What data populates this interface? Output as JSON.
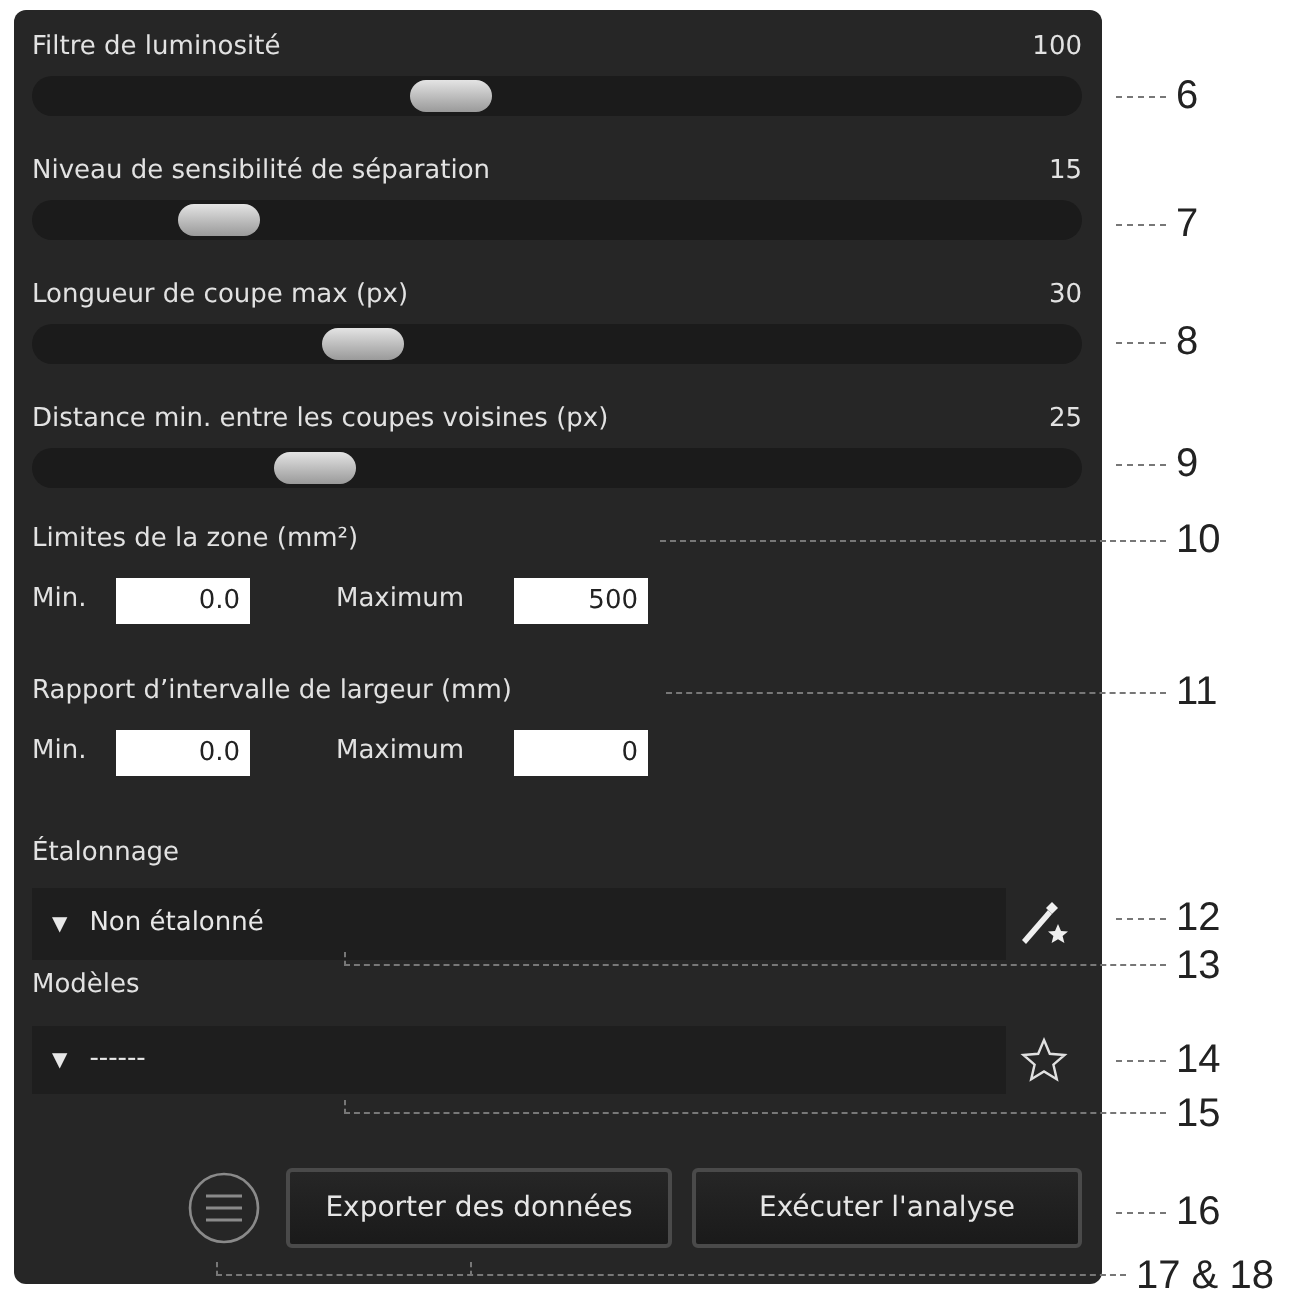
{
  "sliders": [
    {
      "label": "Filtre de luminosité",
      "reading": "100",
      "level": 0.39
    },
    {
      "label": "Niveau de sensibilité de séparation",
      "reading": "15",
      "level": 0.15
    },
    {
      "label": "Longueur de coupe max (px)",
      "reading": "30",
      "level": 0.3
    },
    {
      "label": "Distance min. entre les coupes voisines (px)",
      "reading": "25",
      "level": 0.25
    }
  ],
  "ranges": [
    {
      "label": "Limites de la zone (mm²)",
      "min_label": "Min.",
      "min_value": "0.0",
      "max_label": "Maximum",
      "max_value": "500"
    },
    {
      "label": "Rapport d’intervalle de largeur (mm)",
      "min_label": "Min.",
      "min_value": "0.0",
      "max_label": "Maximum",
      "max_value": "0"
    }
  ],
  "calibration": {
    "label": "Étalonnage",
    "arrow": "▼",
    "value": "Non étalonné"
  },
  "models": {
    "label": "Modèles",
    "arrow": "▼",
    "value": "------"
  },
  "buttons": [
    "Exporter des données",
    "Exécuter l'analyse"
  ],
  "callouts": [
    "6",
    "7",
    "8",
    "9",
    "10",
    "11",
    "12",
    "13",
    "14",
    "15",
    "16",
    "17 & 18"
  ]
}
